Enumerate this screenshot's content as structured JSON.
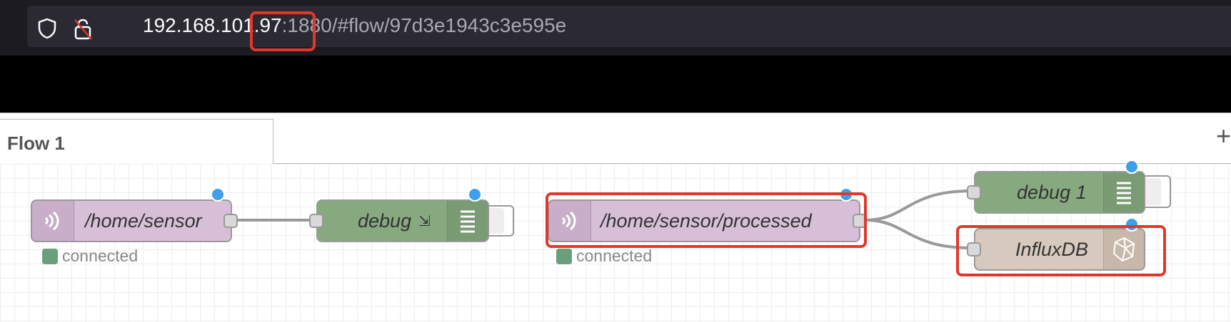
{
  "browser": {
    "url_host": "192.168.101.97",
    "url_rest": ":1880/#flow/97d3e1943c3e595e"
  },
  "editor": {
    "tab_label": "Flow 1",
    "add_tab": "+"
  },
  "nodes": {
    "mqtt_in_1": {
      "label": "/home/sensor",
      "status": "connected"
    },
    "debug": {
      "label": "debug",
      "arrow": "⇲"
    },
    "mqtt_in_2": {
      "label": "/home/sensor/processed",
      "status": "connected"
    },
    "debug_1": {
      "label": "debug 1"
    },
    "influxdb": {
      "label": "InfluxDB"
    }
  },
  "colors": {
    "mqtt": "#d8bfd8",
    "debug": "#87a980",
    "influx": "#d7c9bd",
    "highlight": "#e0392b",
    "changed_dot": "#3ea0ec"
  },
  "icons": [
    "shield-icon",
    "insecure-lock-icon",
    "mqtt-icon",
    "debug-list-icon",
    "influxdb-icon"
  ]
}
